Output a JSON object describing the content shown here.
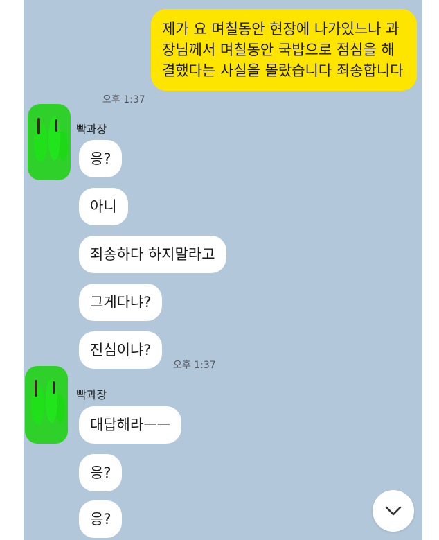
{
  "messages": [
    {
      "type": "sent",
      "text": "제가 요 며칠동안 현장에 나가있느나 과장님께서 며칠동안 국밥으로 점심을 해결했다는 사실을 몰랐습니다 죄송합니다",
      "time": "오후 1:37"
    },
    {
      "type": "received",
      "sender": "빡과장",
      "text": "응?"
    },
    {
      "type": "received",
      "text": "아니"
    },
    {
      "type": "received",
      "text": "죄송하다 하지말라고"
    },
    {
      "type": "received",
      "text": "그게다냐?"
    },
    {
      "type": "received",
      "text": "진심이냐?",
      "time": "오후 1:37"
    },
    {
      "type": "received",
      "sender": "빡과장",
      "text": "대답해라ㅡㅡ"
    },
    {
      "type": "received",
      "text": "응?"
    },
    {
      "type": "received",
      "text": "응?"
    }
  ],
  "scroll_button": {
    "icon": "chevron-down-icon"
  },
  "colors": {
    "background": "#b2c7d9",
    "sent_bubble": "#fee500",
    "received_bubble": "#ffffff"
  }
}
